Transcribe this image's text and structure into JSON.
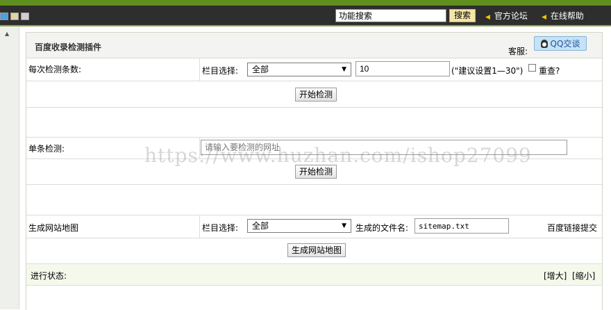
{
  "topbar": {
    "search_value": "功能搜索",
    "search_button": "搜索",
    "links": [
      "官方论坛",
      "在线帮助"
    ]
  },
  "panel": {
    "title": "百度收录检测插件",
    "kefu_label": "客服:",
    "qq_button": "QQ交谈"
  },
  "batch_check": {
    "label": "每次检测条数:",
    "column_label": "栏目选择:",
    "column_value": "全部",
    "count_value": "10",
    "hint": "(\"建议设置1—30\")",
    "recheck_label": "重查?",
    "start_button": "开始检测"
  },
  "single_check": {
    "label": "单条检测:",
    "url_placeholder": "请输入要检测的网址",
    "start_button": "开始检测"
  },
  "sitemap": {
    "label": "生成网站地图",
    "column_label": "栏目选择:",
    "column_value": "全部",
    "filename_label": "生成的文件名:",
    "filename_value": "sitemap.txt",
    "submit_link": "百度链接提交",
    "generate_button": "生成网站地图"
  },
  "status": {
    "label": "进行状态:",
    "enlarge": "[增大]",
    "shrink": "[缩小]"
  },
  "watermark": "https://www.huzhan.com/ishop27099",
  "colors": {
    "topbar": "#2e2e2e",
    "accent_green": "#5f8f1e",
    "search_button": "#f4e6a8",
    "qq_button": "#c5e3f5",
    "status_row": "#f5f9ec"
  }
}
